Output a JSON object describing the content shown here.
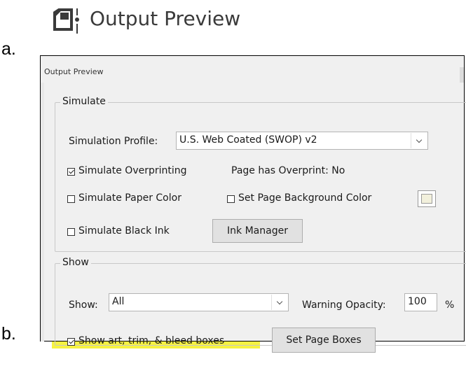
{
  "labels": {
    "a": "a.",
    "b": "b."
  },
  "header": {
    "title": "Output Preview",
    "icon": "output-preview-icon"
  },
  "dialog": {
    "title": "Output Preview",
    "simulate": {
      "legend": "Simulate",
      "profile_label": "Simulation Profile:",
      "profile_value": "U.S. Web Coated (SWOP) v2",
      "simulate_overprinting": {
        "label": "Simulate Overprinting",
        "checked": true
      },
      "overprint_status": "Page has Overprint:  No",
      "simulate_paper_color": {
        "label": "Simulate Paper Color",
        "checked": false
      },
      "set_page_background": {
        "label": "Set Page Background Color",
        "checked": false
      },
      "background_swatch_color": "#f2f0dc",
      "simulate_black_ink": {
        "label": "Simulate Black Ink",
        "checked": false
      },
      "ink_manager_label": "Ink Manager"
    },
    "show": {
      "legend": "Show",
      "show_label": "Show:",
      "show_value": "All",
      "warning_opacity_label": "Warning Opacity:",
      "warning_opacity_value": "100",
      "warning_opacity_unit": "%",
      "show_boxes": {
        "label": "Show art, trim, & bleed boxes",
        "checked": true
      },
      "set_page_boxes_label": "Set Page Boxes"
    }
  },
  "highlight_color": "#f5f020"
}
